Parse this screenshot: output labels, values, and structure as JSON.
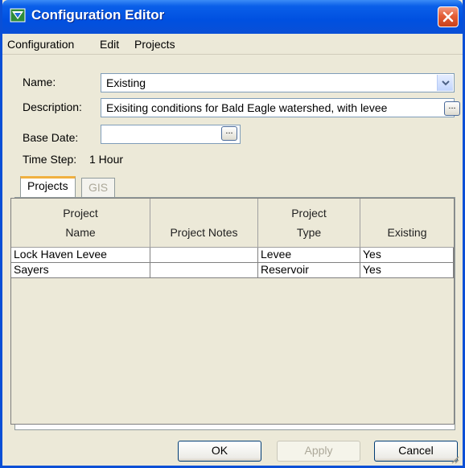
{
  "window": {
    "title": "Configuration Editor"
  },
  "menu": [
    "Configuration",
    "Edit",
    "Projects"
  ],
  "form": {
    "name_label": "Name:",
    "name_value": "Existing",
    "description_label": "Description:",
    "description_value": "Exisiting conditions for Bald Eagle watershed, with levee",
    "base_date_label": "Base Date:",
    "base_date_value": "",
    "time_step_label": "Time Step:",
    "time_step_value": "1 Hour",
    "ellipsis": "..."
  },
  "tabs": [
    {
      "label": "Projects",
      "active": true
    },
    {
      "label": "GIS",
      "active": false
    }
  ],
  "table": {
    "headers": [
      {
        "line1": "Project",
        "line2": "Name"
      },
      {
        "line1": "",
        "line2": "Project Notes"
      },
      {
        "line1": "Project",
        "line2": "Type"
      },
      {
        "line1": "",
        "line2": "Existing"
      }
    ],
    "rows": [
      {
        "name": "Lock Haven Levee",
        "notes": "",
        "type": "Levee",
        "existing": "Yes"
      },
      {
        "name": "Sayers",
        "notes": "",
        "type": "Reservoir",
        "existing": "Yes"
      }
    ]
  },
  "buttons": {
    "ok": "OK",
    "apply": "Apply",
    "cancel": "Cancel"
  },
  "colors": {
    "titlebar": "#0a4fd6",
    "close": "#e35d36",
    "tab_accent": "#f0b040",
    "panel": "#ece9d8"
  }
}
